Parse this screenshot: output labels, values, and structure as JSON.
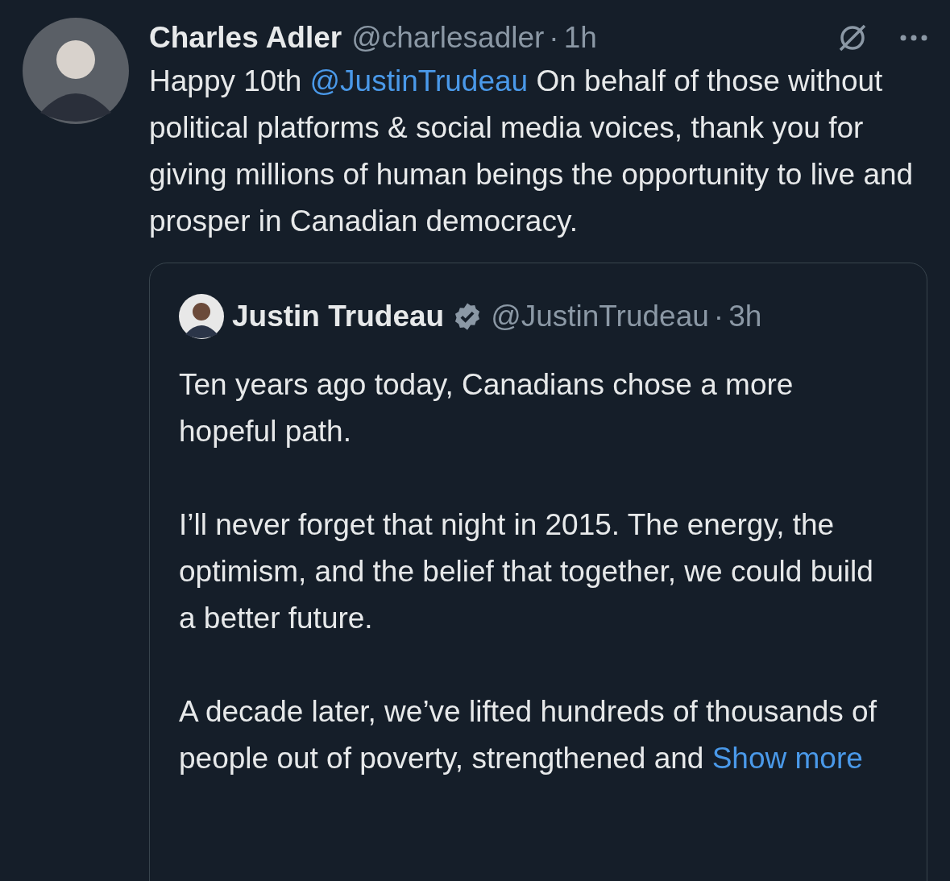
{
  "post": {
    "author": "Charles Adler",
    "handle": "@charlesadler",
    "separator": "·",
    "time": "1h",
    "body": [
      {
        "kind": "plain",
        "text": "Happy 10th "
      },
      {
        "kind": "mention",
        "text": "@JustinTrudeau"
      },
      {
        "kind": "plain",
        "text": " On behalf of those without political platforms & social media voices, thank you for giving millions of human beings the opportunity to live and prosper in Canadian democracy."
      }
    ],
    "quote": {
      "author": "Justin Trudeau",
      "verified": true,
      "handle": "@JustinTrudeau",
      "separator": "·",
      "time": "3h",
      "paragraphs": [
        [
          {
            "kind": "plain",
            "text": "Ten years ago today, Canadians chose a more hopeful path."
          }
        ],
        [
          {
            "kind": "plain",
            "text": "I’ll never forget that night in 2015. The energy, the optimism, and the belief that together, we could build a better future."
          }
        ],
        [
          {
            "kind": "plain",
            "text": "A decade later, we’ve lifted hundreds of thousands of people out of poverty, strengthened and "
          },
          {
            "kind": "more",
            "text": "Show more"
          }
        ]
      ]
    }
  }
}
